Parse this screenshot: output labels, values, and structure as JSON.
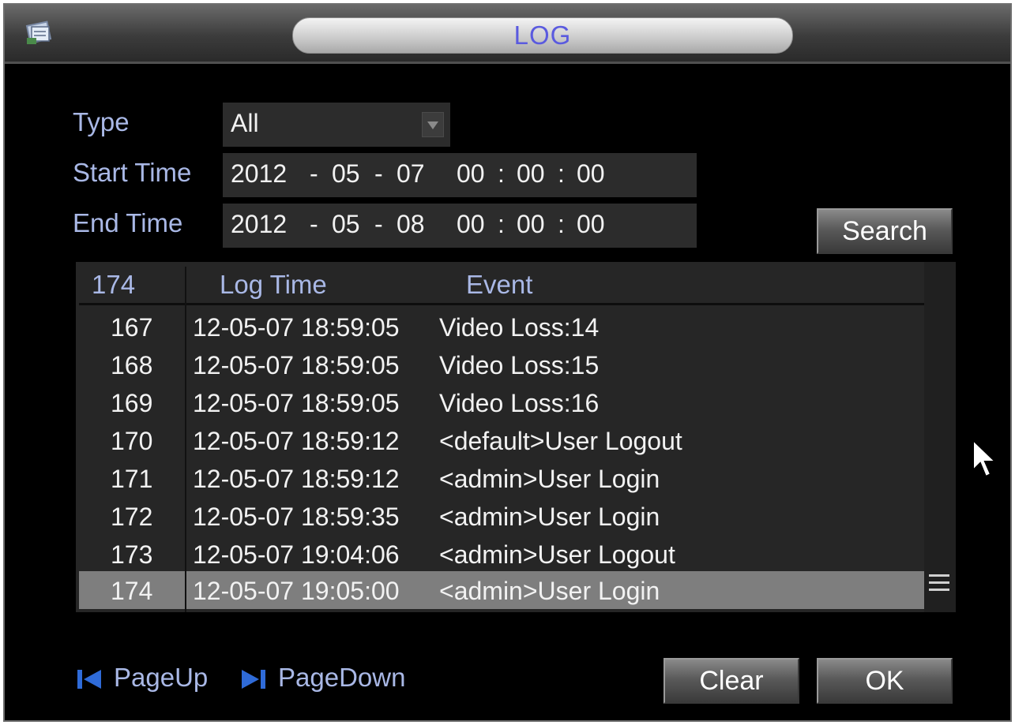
{
  "window": {
    "title": "LOG"
  },
  "filters": {
    "type_label": "Type",
    "type_value": "All",
    "start_label": "Start Time",
    "start": {
      "year": "2012",
      "month": "05",
      "day": "07",
      "hour": "00",
      "minute": "00",
      "second": "00"
    },
    "end_label": "End Time",
    "end": {
      "year": "2012",
      "month": "05",
      "day": "08",
      "hour": "00",
      "minute": "00",
      "second": "00"
    },
    "date_sep": "-",
    "time_sep": ":",
    "search_label": "Search"
  },
  "table": {
    "headers": {
      "count": "174",
      "log_time": "Log Time",
      "event": "Event"
    },
    "rows": [
      {
        "num": "167",
        "time": "12-05-07 18:59:05",
        "event": "Video Loss:14"
      },
      {
        "num": "168",
        "time": "12-05-07 18:59:05",
        "event": "Video Loss:15"
      },
      {
        "num": "169",
        "time": "12-05-07 18:59:05",
        "event": "Video Loss:16"
      },
      {
        "num": "170",
        "time": "12-05-07 18:59:12",
        "event": "<default>User Logout"
      },
      {
        "num": "171",
        "time": "12-05-07 18:59:12",
        "event": "<admin>User Login"
      },
      {
        "num": "172",
        "time": "12-05-07 18:59:35",
        "event": "<admin>User Login"
      },
      {
        "num": "173",
        "time": "12-05-07 19:04:06",
        "event": "<admin>User Logout"
      },
      {
        "num": "174",
        "time": "12-05-07 19:05:00",
        "event": "<admin>User Login"
      }
    ],
    "selected_row": 7
  },
  "footer": {
    "page_up_label": "PageUp",
    "page_down_label": "PageDown",
    "clear_label": "Clear",
    "ok_label": "OK"
  },
  "icons": {
    "title": "log-icon",
    "page_up": "page-up-icon",
    "page_down": "page-down-icon",
    "dropdown": "chevron-down-icon",
    "scroll": "scroll-grip-icon",
    "cursor": "mouse-cursor-icon"
  },
  "colors": {
    "title_text": "#5a5adf",
    "label_text": "#a9b8e6",
    "selected_row": "#7e7e7e",
    "nav_icon": "#2f6bd8"
  }
}
